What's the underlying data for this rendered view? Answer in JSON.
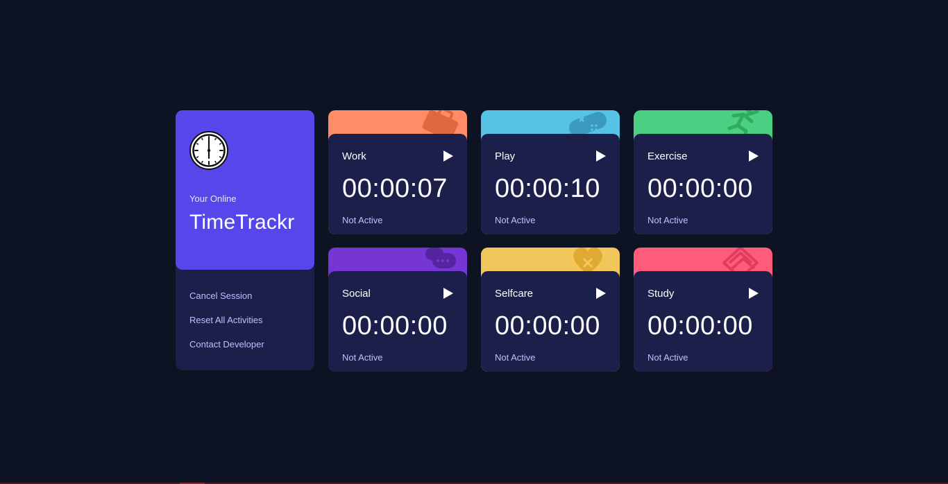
{
  "profile": {
    "subtitle": "Your Online",
    "title": "TimeTrackr",
    "icon": "clock-icon",
    "color": "#5747ea"
  },
  "menu": [
    {
      "label": "Cancel Session"
    },
    {
      "label": "Reset All Activities"
    },
    {
      "label": "Contact Developer"
    }
  ],
  "activities": [
    {
      "title": "Work",
      "time": "00:00:07",
      "status": "Not Active",
      "color": "#ff8c66",
      "icon": "briefcase-icon"
    },
    {
      "title": "Play",
      "time": "00:00:10",
      "status": "Not Active",
      "color": "#56c2e6",
      "icon": "gamepad-icon"
    },
    {
      "title": "Exercise",
      "time": "00:00:00",
      "status": "Not Active",
      "color": "#4bcf82",
      "icon": "running-icon"
    },
    {
      "title": "Social",
      "time": "00:00:00",
      "status": "Not Active",
      "color": "#7536d3",
      "icon": "chat-icon"
    },
    {
      "title": "Selfcare",
      "time": "00:00:00",
      "status": "Not Active",
      "color": "#f1c75b",
      "icon": "heart-icon"
    },
    {
      "title": "Study",
      "time": "00:00:00",
      "status": "Not Active",
      "color": "#ff5c7c",
      "icon": "book-icon"
    }
  ]
}
